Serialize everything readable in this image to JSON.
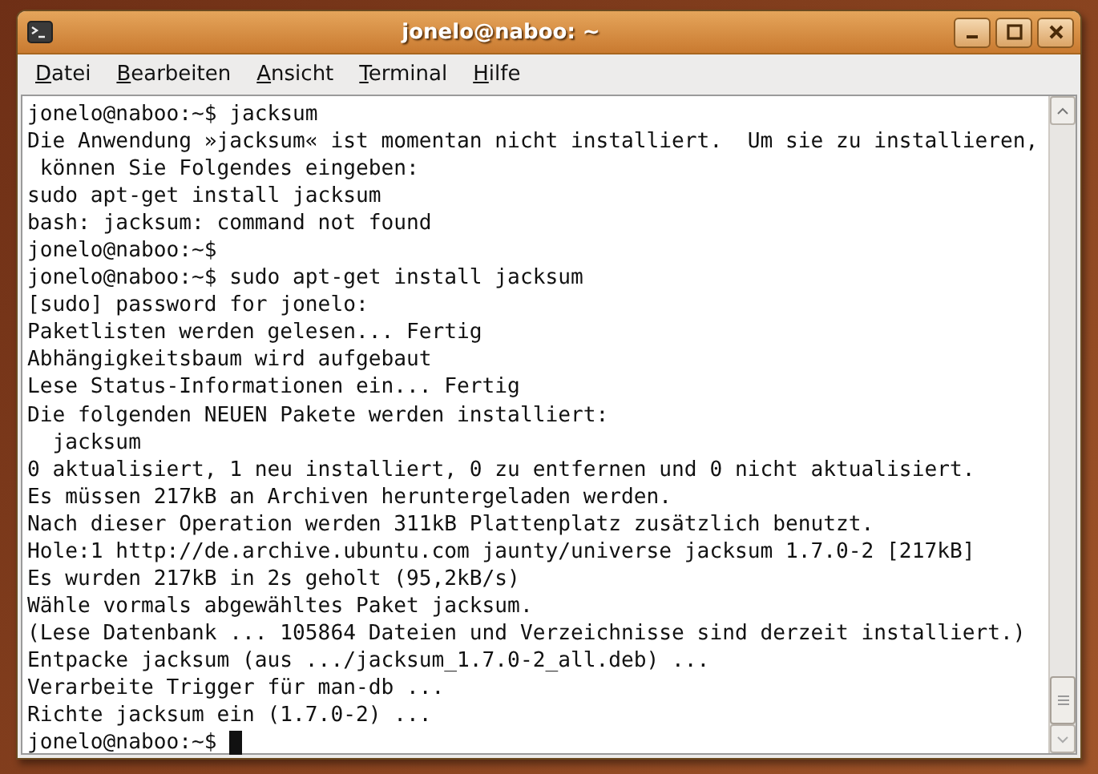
{
  "window": {
    "title": "jonelo@naboo: ~"
  },
  "menu": [
    {
      "label": "Datei"
    },
    {
      "label": "Bearbeiten"
    },
    {
      "label": "Ansicht"
    },
    {
      "label": "Terminal"
    },
    {
      "label": "Hilfe"
    }
  ],
  "terminal": {
    "lines": [
      "jonelo@naboo:~$ jacksum",
      "Die Anwendung »jacksum« ist momentan nicht installiert.  Um sie zu installieren,",
      " können Sie Folgendes eingeben:",
      "sudo apt-get install jacksum",
      "bash: jacksum: command not found",
      "jonelo@naboo:~$",
      "jonelo@naboo:~$ sudo apt-get install jacksum",
      "[sudo] password for jonelo:",
      "Paketlisten werden gelesen... Fertig",
      "Abhängigkeitsbaum wird aufgebaut",
      "Lese Status-Informationen ein... Fertig",
      "Die folgenden NEUEN Pakete werden installiert:",
      "  jacksum",
      "0 aktualisiert, 1 neu installiert, 0 zu entfernen und 0 nicht aktualisiert.",
      "Es müssen 217kB an Archiven heruntergeladen werden.",
      "Nach dieser Operation werden 311kB Plattenplatz zusätzlich benutzt.",
      "Hole:1 http://de.archive.ubuntu.com jaunty/universe jacksum 1.7.0-2 [217kB]",
      "Es wurden 217kB in 2s geholt (95,2kB/s)",
      "Wähle vormals abgewähltes Paket jacksum.",
      "(Lese Datenbank ... 105864 Dateien und Verzeichnisse sind derzeit installiert.)",
      "Entpacke jacksum (aus .../jacksum_1.7.0-2_all.deb) ...",
      "Verarbeite Trigger für man-db ...",
      "Richte jacksum ein (1.7.0-2) ...",
      "jonelo@naboo:~$"
    ],
    "cursor_visible": true
  }
}
